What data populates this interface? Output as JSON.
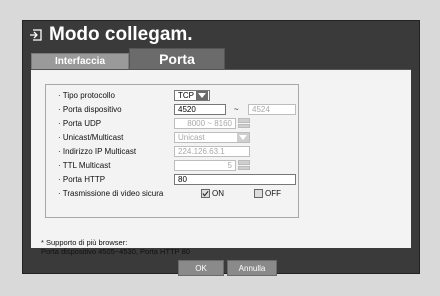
{
  "window": {
    "title": "Modo collegam."
  },
  "tabs": [
    {
      "label": "Interfaccia",
      "active": false
    },
    {
      "label": "Porta",
      "active": true
    }
  ],
  "fields": {
    "protocol": {
      "label": "· Tipo protocollo",
      "value": "TCP"
    },
    "device_port": {
      "label": "· Porta dispositivo",
      "value": "4520",
      "separator": "~",
      "value_end": "4524"
    },
    "udp_port": {
      "label": "· Porta UDP",
      "value": "8000 ~ 8160"
    },
    "unicast_multicast": {
      "label": "· Unicast/Multicast",
      "value": "Unicast"
    },
    "multicast_ip": {
      "label": "· Indirizzo IP Multicast",
      "value": "224.126.63.1"
    },
    "ttl_multicast": {
      "label": "· TTL Multicast",
      "value": "5"
    },
    "http_port": {
      "label": "· Porta HTTP",
      "value": "80"
    },
    "secure_video": {
      "label": "· Trasmissione di video sicura",
      "on_label": "ON",
      "off_label": "OFF",
      "on_checked": true,
      "off_checked": false
    }
  },
  "note": {
    "line1": "* Supporto di più browser:",
    "line2": "Porta dispositivo 4505~4530, Porta HTTP 80"
  },
  "buttons": {
    "ok": "OK",
    "cancel": "Annulla"
  },
  "colors": {
    "window_bg": "#3a3a3a",
    "panel_bg": "#f3f3f3",
    "active_tab": "#6b6b6b",
    "inactive_tab": "#9a9a9a"
  }
}
